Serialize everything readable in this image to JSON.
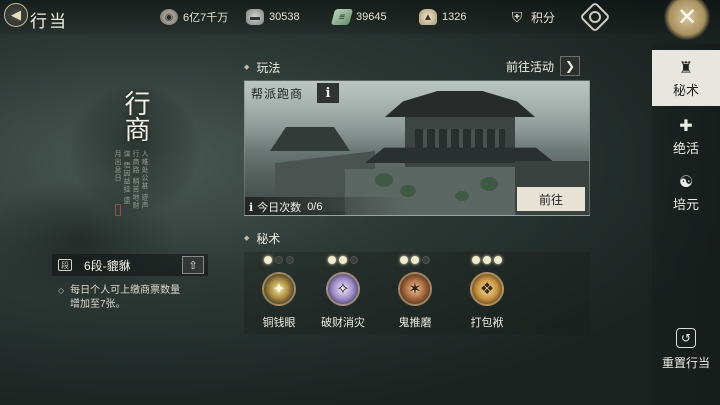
{
  "header": {
    "title": "行当",
    "resources": [
      {
        "icon": "coin-bag-icon",
        "value": "6亿7千万"
      },
      {
        "icon": "silver-ingot-icon",
        "value": "30538"
      },
      {
        "icon": "ticket-icon",
        "value": "39645"
      },
      {
        "icon": "gold-ingot-icon",
        "value": "1326"
      }
    ],
    "points_label": "积分",
    "back_glyph": "◀",
    "close_glyph": "✕"
  },
  "profession": {
    "name": "行商",
    "poem": "人难处公甚 迹声行商路 稍苦地财谋 悟因益挂 盛月出息日",
    "rank": "6段-貔貅",
    "rank_up_glyph": "⇧",
    "desc_line1": "每日个人可上缴商票数量",
    "desc_line2": "增加至7张。"
  },
  "gameplay": {
    "section_title": "玩法",
    "goto_label": "前往活动",
    "goto_glyph": "❯",
    "card_tag": "帮派跑商",
    "info_glyph": "i",
    "daily_label": "今日次数",
    "daily_value": "0/6",
    "go_button": "前往"
  },
  "secret_arts": {
    "section_title": "秘术",
    "skills": [
      {
        "name": "铜钱眼",
        "level": 1,
        "max": 3,
        "glyph": "✦"
      },
      {
        "name": "破财消灾",
        "level": 2,
        "max": 3,
        "glyph": "✧"
      },
      {
        "name": "鬼推磨",
        "level": 2,
        "max": 3,
        "glyph": "✶"
      },
      {
        "name": "打包袱",
        "level": 3,
        "max": 3,
        "glyph": "❖"
      }
    ]
  },
  "side_tabs": [
    {
      "label": "秘术",
      "icon": "scroll-icon",
      "glyph": "♜",
      "active": true
    },
    {
      "label": "绝活",
      "icon": "technique-icon",
      "glyph": "✚",
      "active": false
    },
    {
      "label": "培元",
      "icon": "cultivate-icon",
      "glyph": "☯",
      "active": false
    }
  ],
  "reset": {
    "label": "重置行当",
    "glyph": "↺"
  }
}
